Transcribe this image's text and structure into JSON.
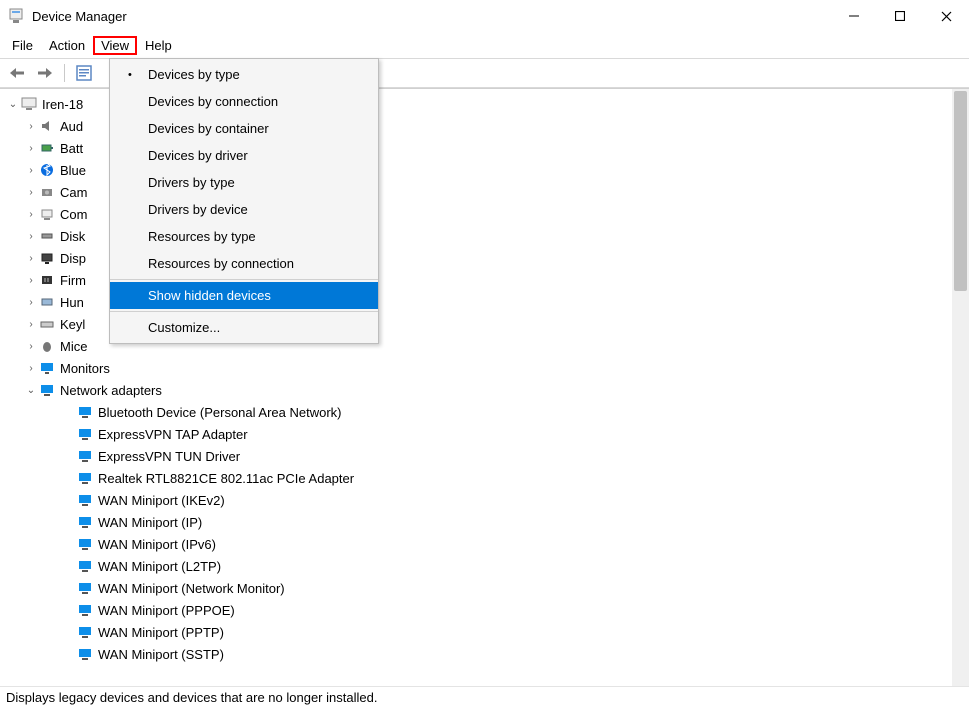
{
  "window": {
    "title": "Device Manager"
  },
  "menubar": {
    "file": "File",
    "action": "Action",
    "view": "View",
    "help": "Help"
  },
  "dropdown": {
    "devices_by_type": "Devices by type",
    "devices_by_connection": "Devices by connection",
    "devices_by_container": "Devices by container",
    "devices_by_driver": "Devices by driver",
    "drivers_by_type": "Drivers by type",
    "drivers_by_device": "Drivers by device",
    "resources_by_type": "Resources by type",
    "resources_by_connection": "Resources by connection",
    "show_hidden_devices": "Show hidden devices",
    "customize": "Customize..."
  },
  "tree": {
    "root": "Iren-18",
    "categories": [
      "Aud",
      "Batt",
      "Blue",
      "Cam",
      "Com",
      "Disk",
      "Disp",
      "Firm",
      "Hun",
      "Keyl",
      "Mice"
    ],
    "monitors": "Monitors",
    "network_adapters": "Network adapters",
    "adapters": [
      "Bluetooth Device (Personal Area Network)",
      "ExpressVPN TAP Adapter",
      "ExpressVPN TUN Driver",
      "Realtek RTL8821CE 802.11ac PCIe Adapter",
      "WAN Miniport (IKEv2)",
      "WAN Miniport (IP)",
      "WAN Miniport (IPv6)",
      "WAN Miniport (L2TP)",
      "WAN Miniport (Network Monitor)",
      "WAN Miniport (PPPOE)",
      "WAN Miniport (PPTP)",
      "WAN Miniport (SSTP)"
    ]
  },
  "statusbar": {
    "text": "Displays legacy devices and devices that are no longer installed."
  }
}
